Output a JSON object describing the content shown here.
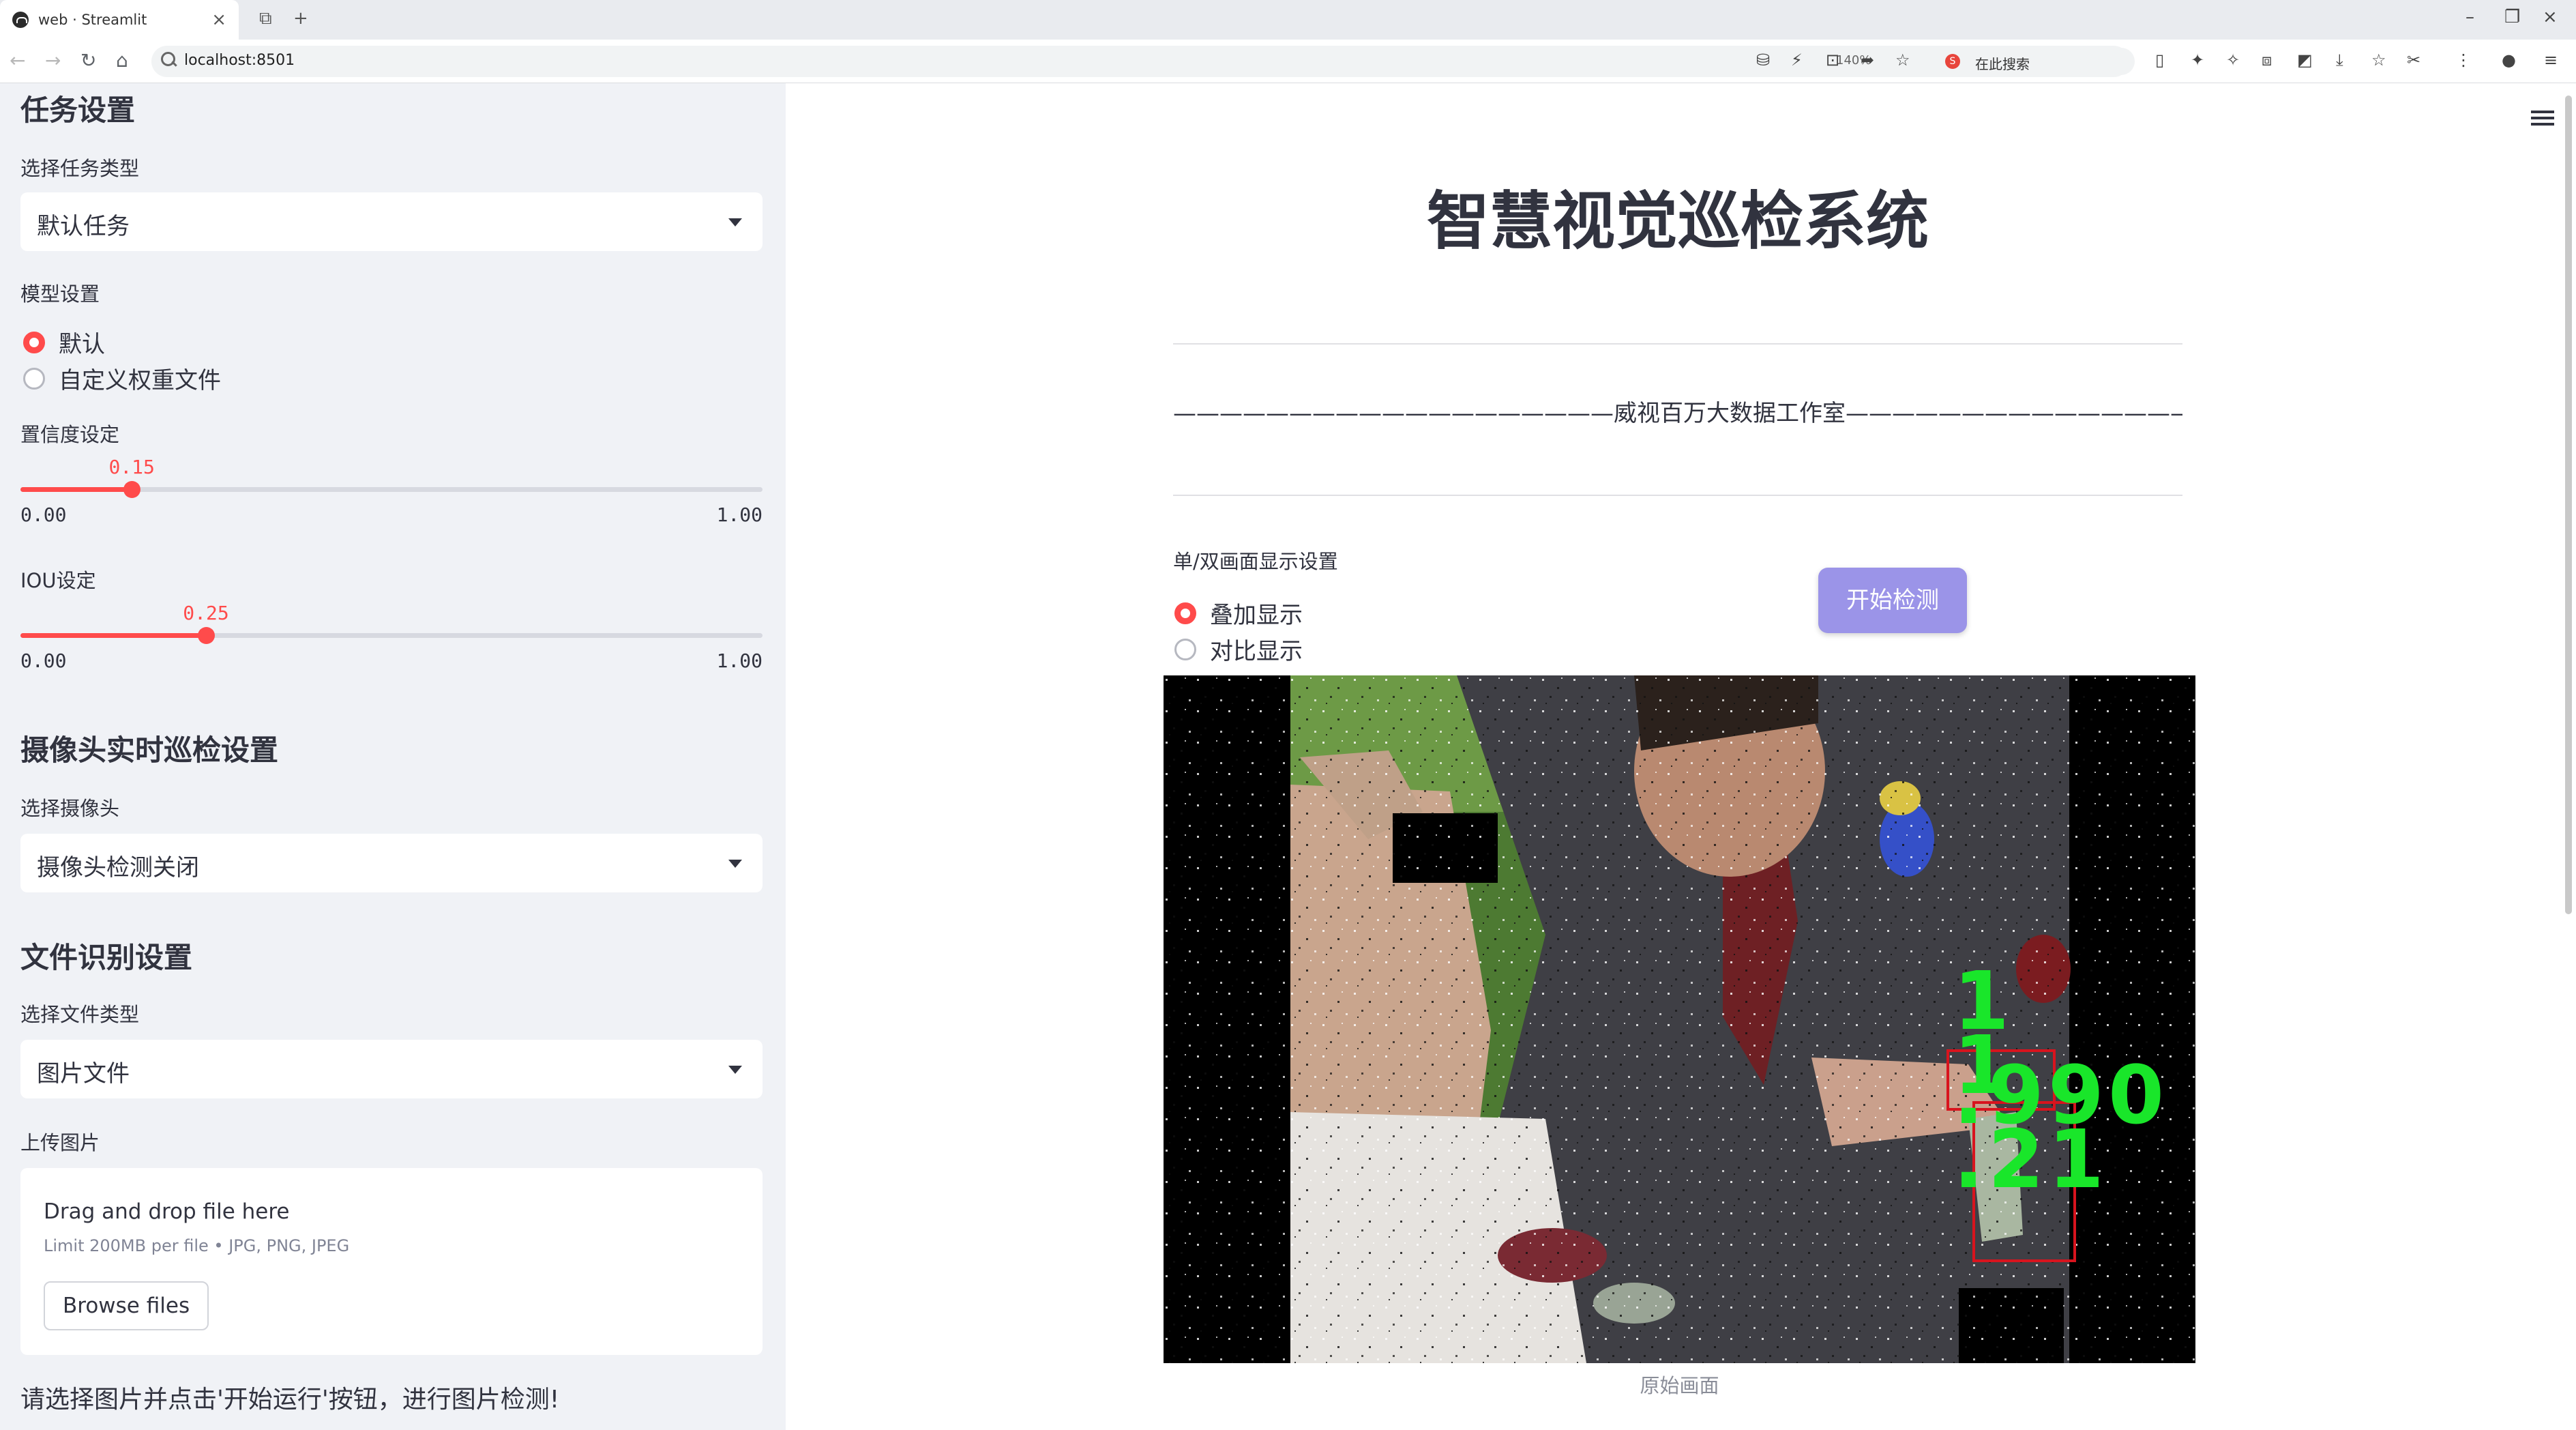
{
  "browser": {
    "tab_title": "web · Streamlit",
    "url": "localhost:8501",
    "zoom": "140%",
    "search_placeholder": "在此搜索"
  },
  "sidebar": {
    "task_header": "任务设置",
    "task_type_label": "选择任务类型",
    "task_type_value": "默认任务",
    "model_label": "模型设置",
    "model_options": [
      "默认",
      "自定义权重文件"
    ],
    "model_selected": 0,
    "conf_label": "置信度设定",
    "conf": {
      "value": 0.15,
      "value_text": "0.15",
      "min": "0.00",
      "max": "1.00"
    },
    "iou_label": "IOU设定",
    "iou": {
      "value": 0.25,
      "value_text": "0.25",
      "min": "0.00",
      "max": "1.00"
    },
    "camera_header": "摄像头实时巡检设置",
    "camera_label": "选择摄像头",
    "camera_value": "摄像头检测关闭",
    "file_header": "文件识别设置",
    "file_type_label": "选择文件类型",
    "file_type_value": "图片文件",
    "upload_label": "上传图片",
    "upload_drag": "Drag and drop file here",
    "upload_limit": "Limit 200MB per file • JPG, PNG, JPEG",
    "browse_label": "Browse files",
    "hint": "请选择图片并点击'开始运行'按钮，进行图片检测!"
  },
  "main": {
    "title": "智慧视觉巡检系统",
    "studio_line": "———————————————————威视百万大数据工作室————————————————————",
    "display_label": "单/双画面显示设置",
    "display_options": [
      "叠加显示",
      "对比显示"
    ],
    "display_selected": 0,
    "start_button": "开始检测",
    "image_caption": "原始画面",
    "detections": [
      "1 .990",
      "1 .21"
    ]
  },
  "colors": {
    "accent": "#ff4b4b",
    "button": "#9b94e8",
    "sidebar_bg": "#f0f2f6",
    "box": "#d8141e",
    "label_green": "#19e62a"
  }
}
